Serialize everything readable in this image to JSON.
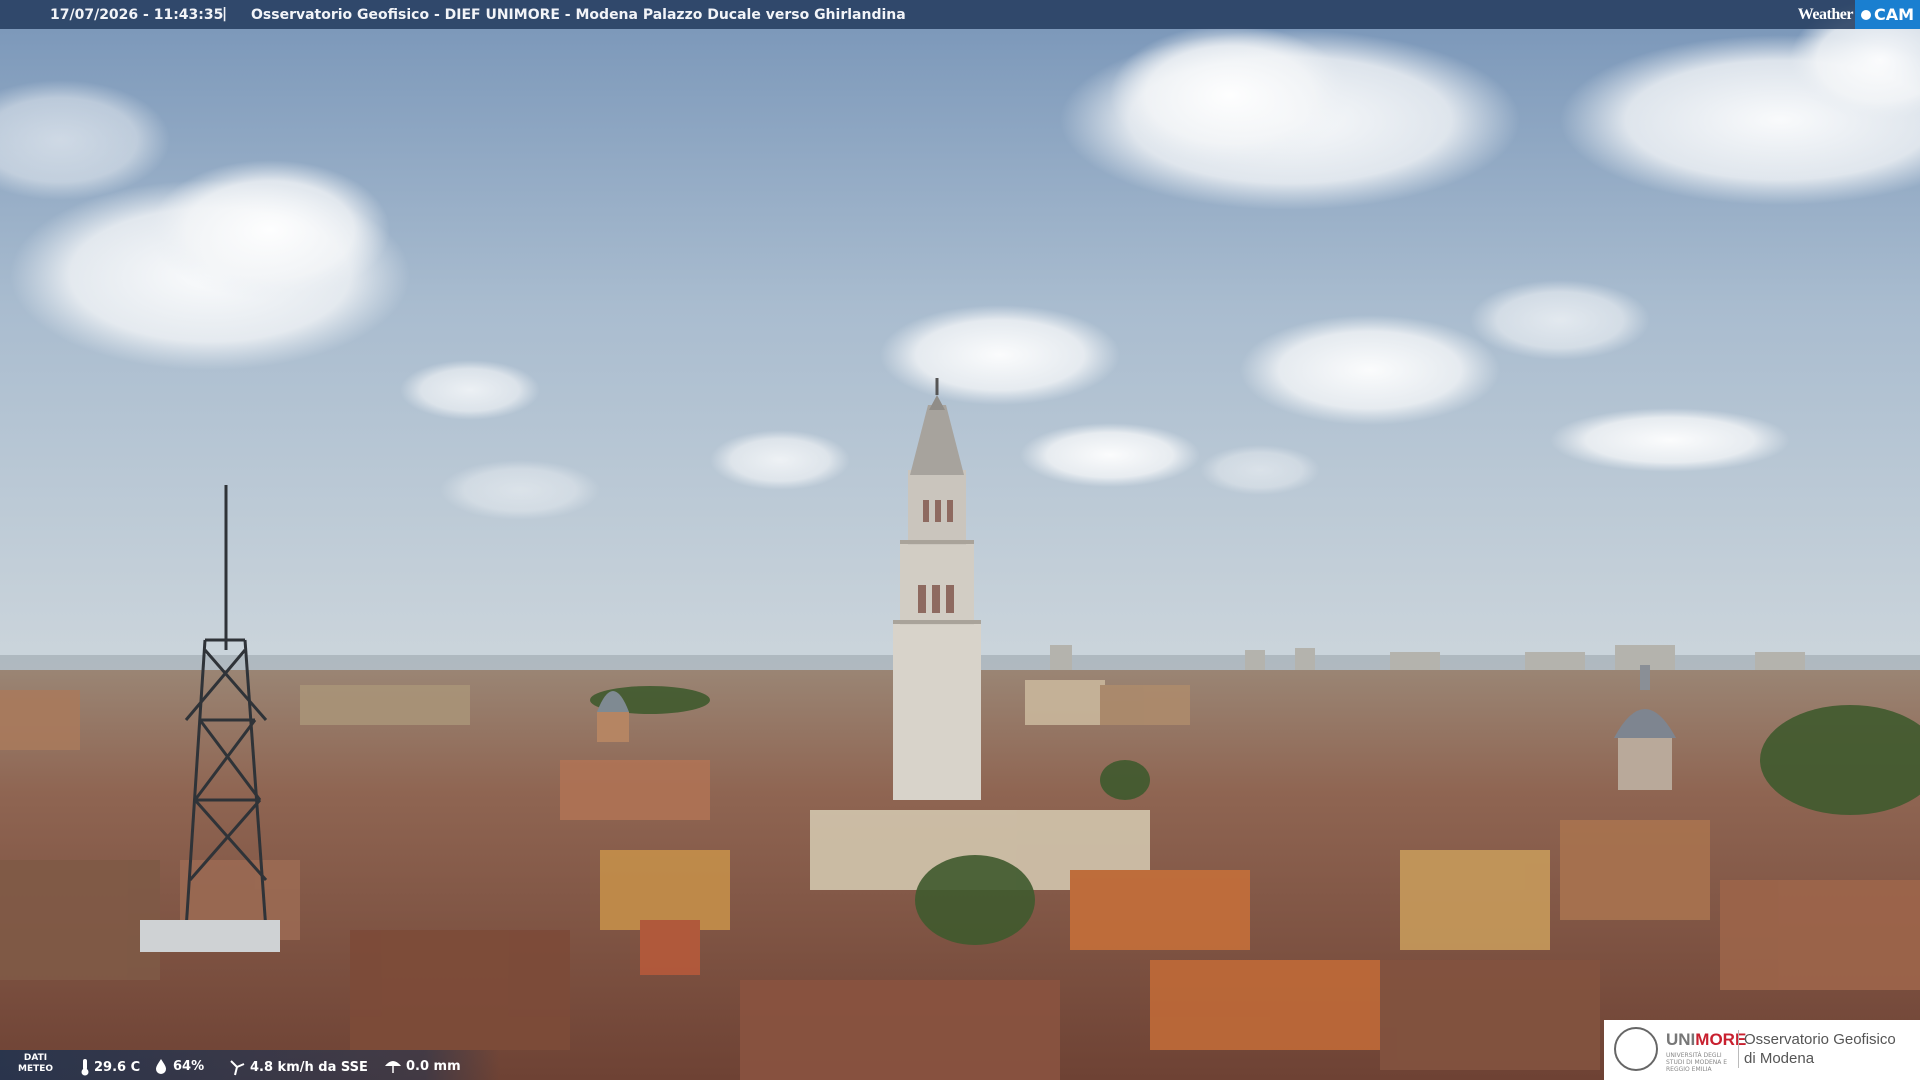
{
  "header": {
    "timestamp": "17/07/2026 - 11:43:35",
    "separator": "|",
    "title": "Osservatorio Geofisico - DIEF UNIMORE - Modena Palazzo Ducale verso Ghirlandina"
  },
  "brand": {
    "part1": "Weather",
    "part2": "CAM"
  },
  "meteo": {
    "tag_line1": "DATI",
    "tag_line2": "METEO",
    "temperature": "29.6 C",
    "humidity": "64%",
    "wind": "4.8 km/h da SSE",
    "rain": "0.0 mm"
  },
  "partner": {
    "university_a": "UNI",
    "university_b": "MORE",
    "university_sub": "UNIVERSITÀ DEGLI STUDI DI MODENA E REGGIO EMILIA",
    "observatory_line1": "Osservatorio Geofisico",
    "observatory_line2": "di Modena"
  },
  "colors": {
    "sky_top": "#7f9dbf",
    "sky_horizon": "#c9d3db",
    "roof": "#8a5a45",
    "tower": "#d8d4cc",
    "brand_blue": "#1a7fd0",
    "unimore_red": "#c8202f"
  }
}
